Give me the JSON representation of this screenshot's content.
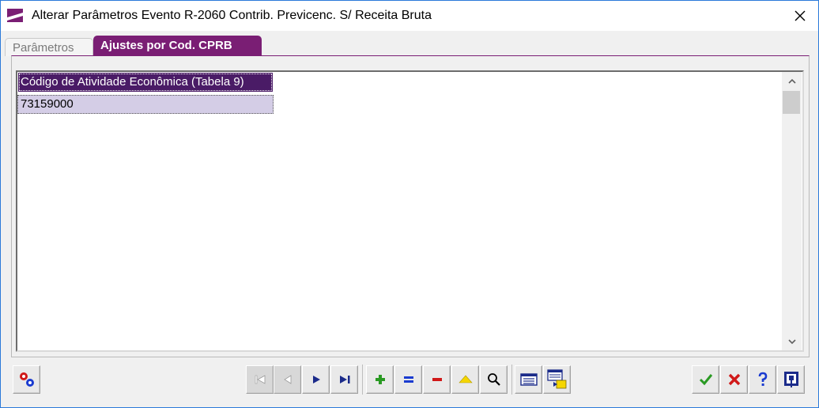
{
  "window": {
    "title": "Alterar Parâmetros Evento R-2060 Contrib. Previcenc. S/ Receita Bruta",
    "accent": "#7a1e74"
  },
  "tabs": [
    {
      "label": "Parâmetros",
      "active": false
    },
    {
      "label": "Ajustes por Cod. CPRB",
      "active": true
    }
  ],
  "grid": {
    "columns": [
      "Código de Atividade Econômica (Tabela 9)"
    ],
    "rows": [
      [
        "73159000"
      ]
    ]
  },
  "toolbar": {
    "left": [
      {
        "icon": "settings-gears-icon"
      }
    ],
    "navigation": [
      {
        "icon": "first-record-icon",
        "enabled": false
      },
      {
        "icon": "previous-record-icon",
        "enabled": false
      },
      {
        "icon": "next-record-icon",
        "enabled": true
      },
      {
        "icon": "last-record-icon",
        "enabled": true
      }
    ],
    "edit": [
      {
        "icon": "add-icon"
      },
      {
        "icon": "edit-icon"
      },
      {
        "icon": "delete-icon"
      },
      {
        "icon": "cancel-edit-icon"
      },
      {
        "icon": "search-icon"
      }
    ],
    "view": [
      {
        "icon": "grid-view-icon"
      },
      {
        "icon": "export-grid-icon"
      }
    ],
    "right": [
      {
        "icon": "confirm-icon"
      },
      {
        "icon": "cancel-icon"
      },
      {
        "icon": "help-icon"
      },
      {
        "icon": "exit-icon"
      }
    ]
  }
}
